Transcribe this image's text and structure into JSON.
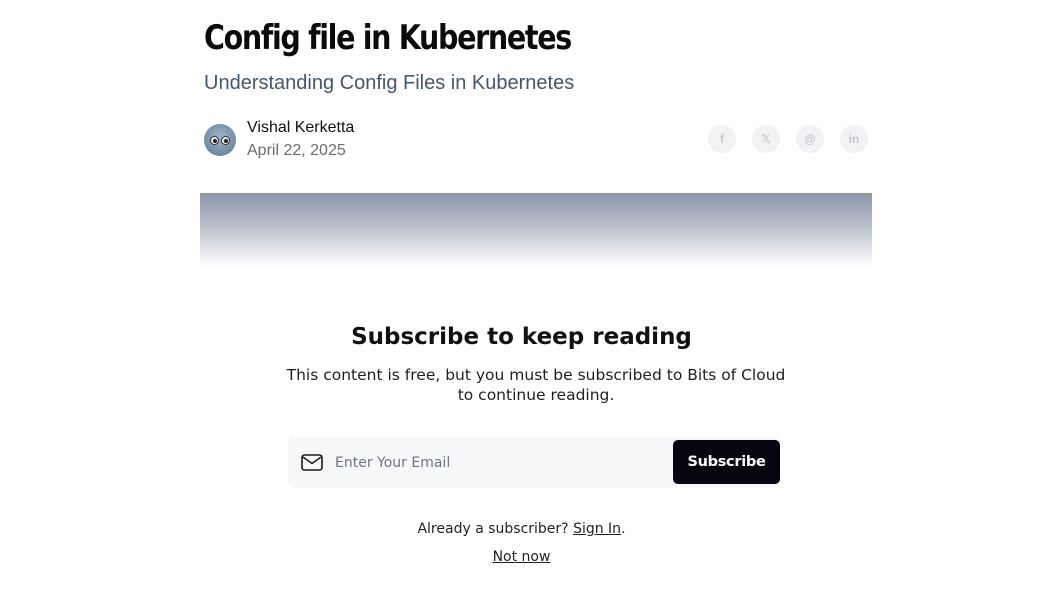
{
  "post": {
    "title": "Config file in Kubernetes",
    "subtitle": "Understanding Config Files in Kubernetes",
    "author": "Vishal Kerketta",
    "date": "April 22, 2025"
  },
  "social": [
    {
      "icon": "facebook-icon",
      "glyph": "f"
    },
    {
      "icon": "x-icon",
      "glyph": "𝕏"
    },
    {
      "icon": "threads-icon",
      "glyph": "@"
    },
    {
      "icon": "linkedin-icon",
      "glyph": "in"
    }
  ],
  "paywall": {
    "title": "Subscribe to keep reading",
    "description": "This content is free, but you must be subscribed to Bits of Cloud to continue reading.",
    "email_placeholder": "Enter Your Email",
    "subscribe_label": "Subscribe",
    "already_text": "Already a subscriber?",
    "signin_label": "Sign In",
    "signin_suffix": ".",
    "not_now_label": "Not now"
  }
}
